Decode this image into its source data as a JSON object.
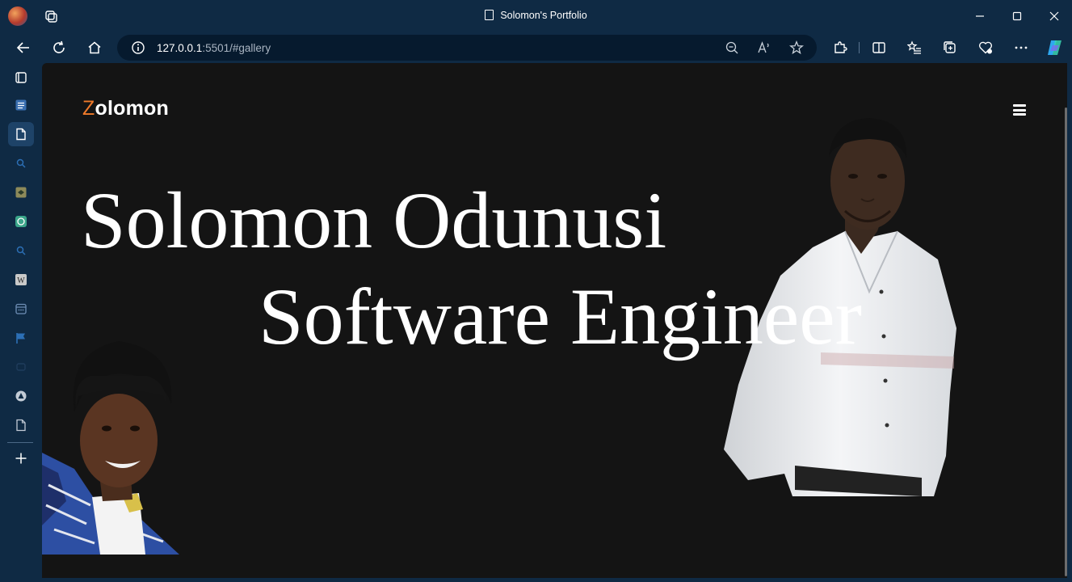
{
  "window": {
    "title": "Solomon's Portfolio"
  },
  "toolbar": {
    "url_host": "127.0.0.1",
    "url_rest": ":5501/#gallery"
  },
  "sidebar": {
    "items": [
      "collections-icon",
      "reading-list-icon",
      "document-icon",
      "search-icon",
      "app-icon",
      "chatgpt-icon",
      "search-icon",
      "wikipedia-icon",
      "calendar-icon",
      "flag-icon",
      "app-icon",
      "drive-icon",
      "file-icon",
      "add-icon"
    ]
  },
  "page": {
    "logo_initial": "Z",
    "logo_rest": "olomon",
    "hero_name": "Solomon Odunusi",
    "hero_role": "Software Engineer"
  },
  "colors": {
    "browser_chrome": "#0f2a44",
    "page_bg": "#141414",
    "logo_accent": "#f07a2a"
  }
}
